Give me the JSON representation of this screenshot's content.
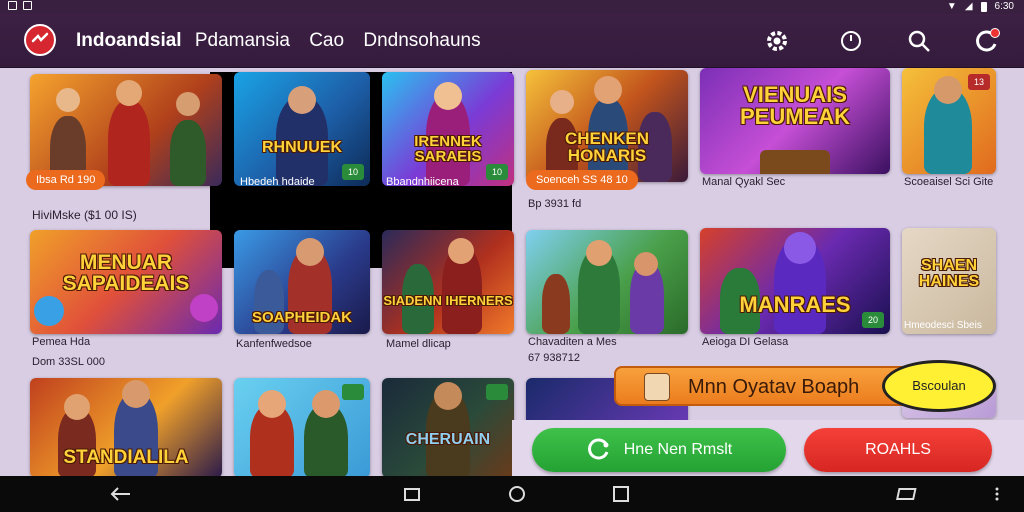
{
  "app": {
    "title_part1": "Indoandsial",
    "title_part2": "Pdamansia",
    "title_part3": "Cao",
    "title_part4": "Dndnsohauns"
  },
  "status_bar": {
    "time": "6:30",
    "icons": [
      "image-icon",
      "image-icon",
      "wifi-icon",
      "signal-icon",
      "battery-icon"
    ]
  },
  "header_actions": [
    "gear-icon",
    "clock-icon",
    "search-icon",
    "notifications-icon"
  ],
  "games": [
    {
      "name": "",
      "pill": "Ibsa Rd 190",
      "caption": "HiviMske ($1 00 IS)"
    },
    {
      "name": "RHNUUEK",
      "caption": "Hbedeh hdaide",
      "chip": "10"
    },
    {
      "name": "IRENNEK SARAEIS",
      "caption": "Bbandnhiicena",
      "chip": "10"
    },
    {
      "name": "CHENKEN HONARIS",
      "pill": "Soenceh  SS 48 10",
      "caption": "Bp 3931 fd"
    },
    {
      "name": "VIENUAIS PEUMEAK",
      "caption": "Manal Qyakl Sec"
    },
    {
      "name": "",
      "caption": "Scoeaisel Sci Gite",
      "chip": "13"
    },
    {
      "name": "MENUAR SAPAIDEAIS",
      "caption": "Pemea Hda",
      "subcaption": "Dom 33SL 000"
    },
    {
      "name": "SOAPHEIDAK",
      "caption": "Kanfenfwedsoe"
    },
    {
      "name": "SIADENN IHERNERS",
      "caption": "Mamel dlicap"
    },
    {
      "name": "",
      "caption": "Chavaditen a Mes",
      "subcaption": "67 938712"
    },
    {
      "name": "MANRAES",
      "caption": "Aeioga DI Gelasa",
      "chip": "20"
    },
    {
      "name": "SHAEN HAINES",
      "caption": "Hmeodesci Sbeis"
    },
    {
      "name": "STANDIALILA",
      "caption": ""
    },
    {
      "name": "",
      "caption": ""
    },
    {
      "name": "CHERUAIN",
      "caption": ""
    }
  ],
  "promo": {
    "banner_text": "Mnn Oyatav Boaph",
    "bubble_text": "Bscoulan"
  },
  "buttons": {
    "green": "Hne Nen Rmslt",
    "red": "ROAHLS"
  },
  "colors": {
    "header": "#3a1e42",
    "content_bg": "#d9cde4",
    "pill": "#ec6a1e",
    "green_button": "#2fb23d",
    "red_button": "#e5302b"
  }
}
